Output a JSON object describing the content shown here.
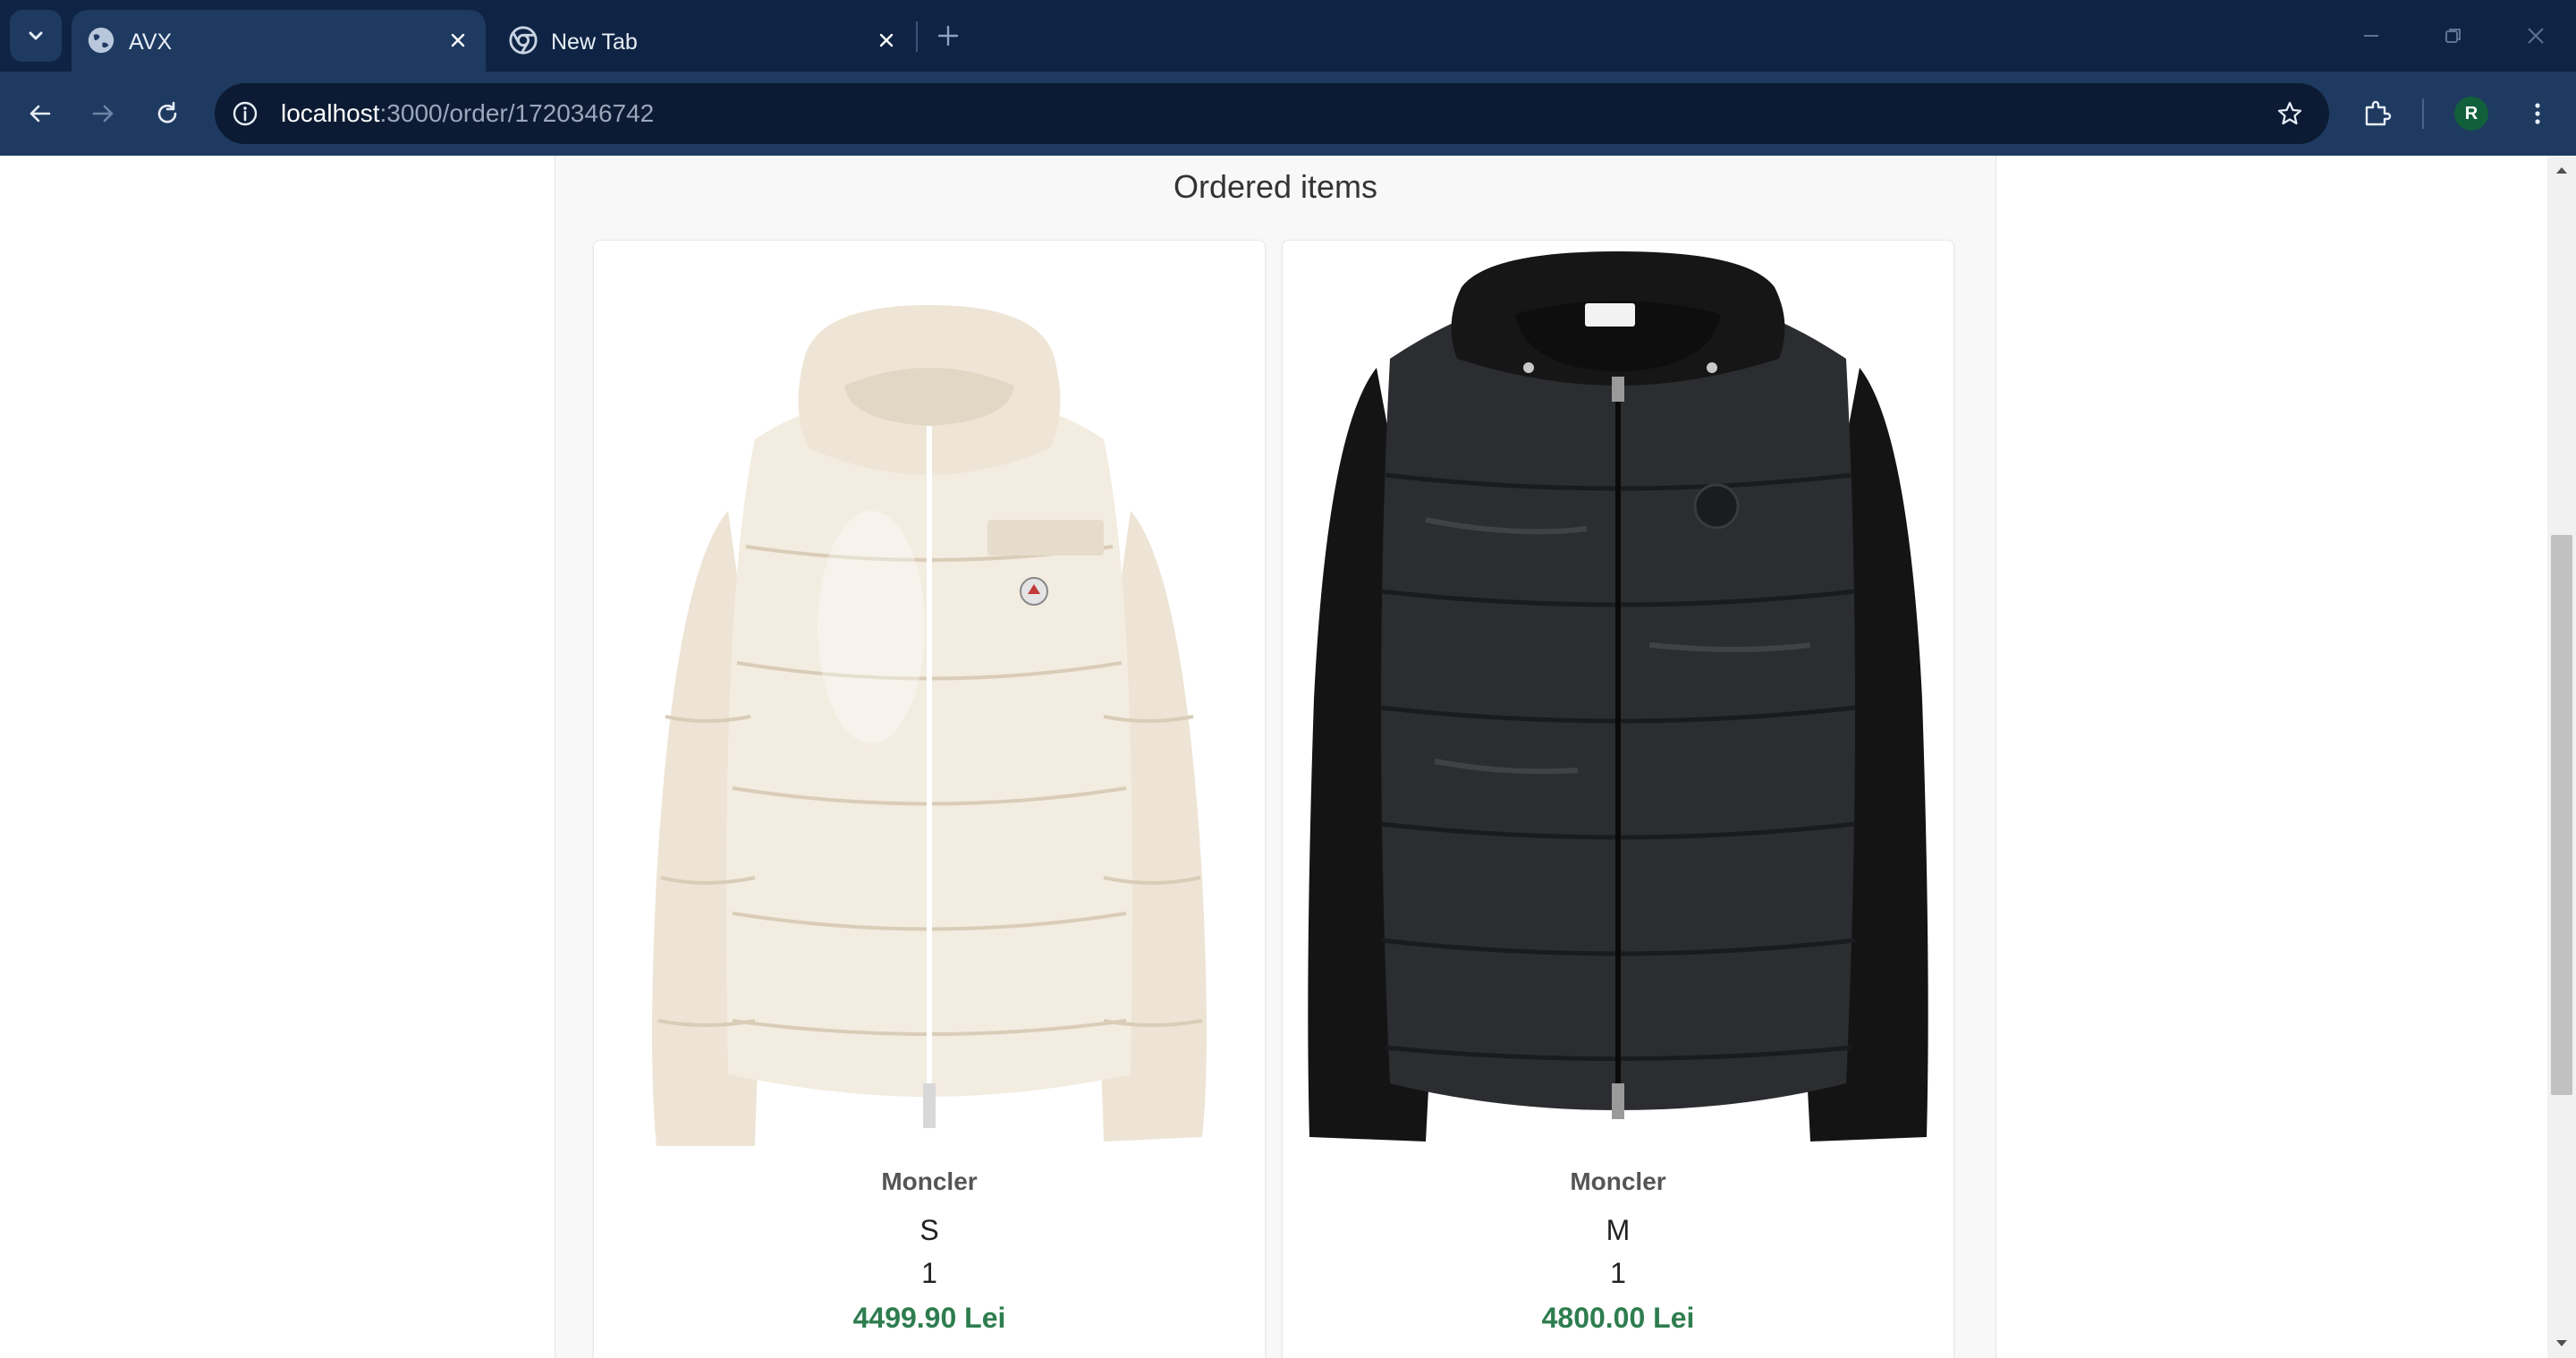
{
  "browser": {
    "tabs": [
      {
        "title": "AVX",
        "active": true
      },
      {
        "title": "New Tab",
        "active": false
      }
    ],
    "address_bar": {
      "host": "localhost",
      "path": ":3000/order/1720346742"
    },
    "profile_initial": "R"
  },
  "page": {
    "section_title": "Ordered items",
    "items": [
      {
        "brand": "Moncler",
        "size": "S",
        "quantity": "1",
        "price": "4499.90 Lei",
        "image": "cream-puffer-jacket"
      },
      {
        "brand": "Moncler",
        "size": "M",
        "quantity": "1",
        "price": "4800.00 Lei",
        "image": "black-hooded-down-cardigan"
      }
    ]
  },
  "colors": {
    "tabstrip": "#0f2444",
    "toolbar": "#1e3a60",
    "price": "#2e7d4f"
  }
}
